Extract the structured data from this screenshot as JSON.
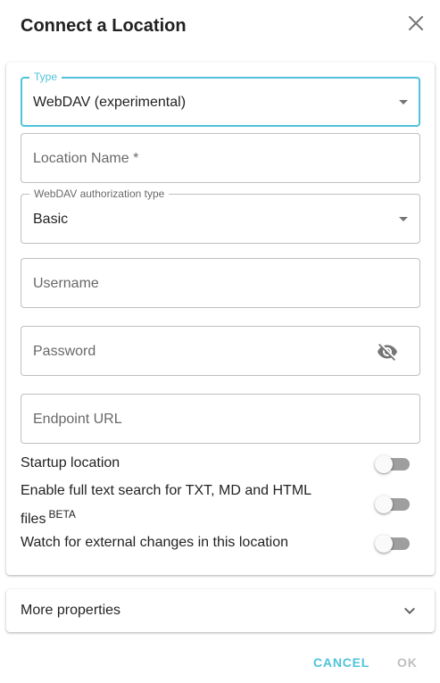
{
  "dialog": {
    "title": "Connect a Location"
  },
  "form": {
    "type_field": {
      "legend": "Type",
      "value": "WebDAV (experimental)"
    },
    "location_name": {
      "placeholder": "Location Name *"
    },
    "auth_type_field": {
      "legend": "WebDAV authorization type",
      "value": "Basic"
    },
    "username": {
      "placeholder": "Username"
    },
    "password": {
      "placeholder": "Password"
    },
    "endpoint": {
      "placeholder": "Endpoint URL"
    }
  },
  "switches": [
    {
      "label": "Startup location",
      "checked": false
    },
    {
      "label": "Enable full text search for TXT, MD and HTML files",
      "badge": "BETA",
      "checked": false
    },
    {
      "label": "Watch for external changes in this location",
      "checked": false
    }
  ],
  "accordion": {
    "label": "More properties"
  },
  "actions": {
    "cancel": "Cancel",
    "ok": "OK"
  },
  "colors": {
    "accent": "#4fc3d9",
    "disabled": "rgba(0,0,0,0.26)"
  }
}
